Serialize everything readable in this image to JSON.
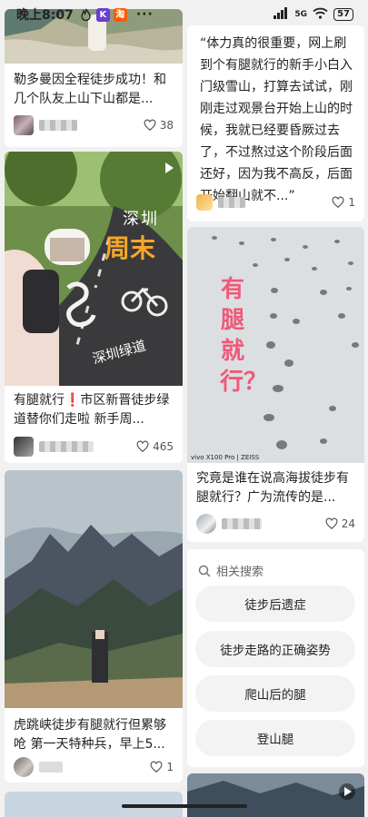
{
  "status_bar": {
    "time": "晚上8:07",
    "app_badge_1": "K",
    "app_badge_2": "淘",
    "more": "···",
    "signal": "5G",
    "battery": "57"
  },
  "feed": {
    "left": [
      {
        "title": "勒多曼因全程徒步成功！和几个队友上山下山都是...",
        "likes": "38"
      },
      {
        "title": "有腿就行❗️市区新晋徒步绿道替你们走啦 新手周...",
        "likes": "465",
        "overlay_text_1": "深圳",
        "overlay_text_2": "周末",
        "overlay_text_3": "深圳绿道"
      },
      {
        "title": "虎跳峡徒步有腿就行但累够呛 第一天特种兵，早上5...",
        "likes": "1"
      }
    ],
    "right": [
      {
        "quote": "“体力真的很重要，网上刷到个有腿就行的新手小白入门级雪山，打算去试试，刚刚走过观景台开始上山的时候，我就已经要昏厥过去了，不过熬过这个阶段后面还好，因为我不高反，后面开始翻山就不...”",
        "likes": "1"
      },
      {
        "overlay_text": "有腿就行？",
        "watermark": "vivo X100 Pro | ZEISS",
        "title": "究竟是谁在说高海拔徒步有腿就行？广为流传的是...",
        "likes": "24"
      }
    ]
  },
  "related_search": {
    "heading": "相关搜索",
    "items": [
      "徒步后遗症",
      "徒步走路的正确姿势",
      "爬山后的腿",
      "登山腿"
    ]
  },
  "colors": {
    "accent_red": "#e8474f",
    "overlay_yellow": "#f4a72a",
    "overlay_pink": "#ee5a7a"
  }
}
